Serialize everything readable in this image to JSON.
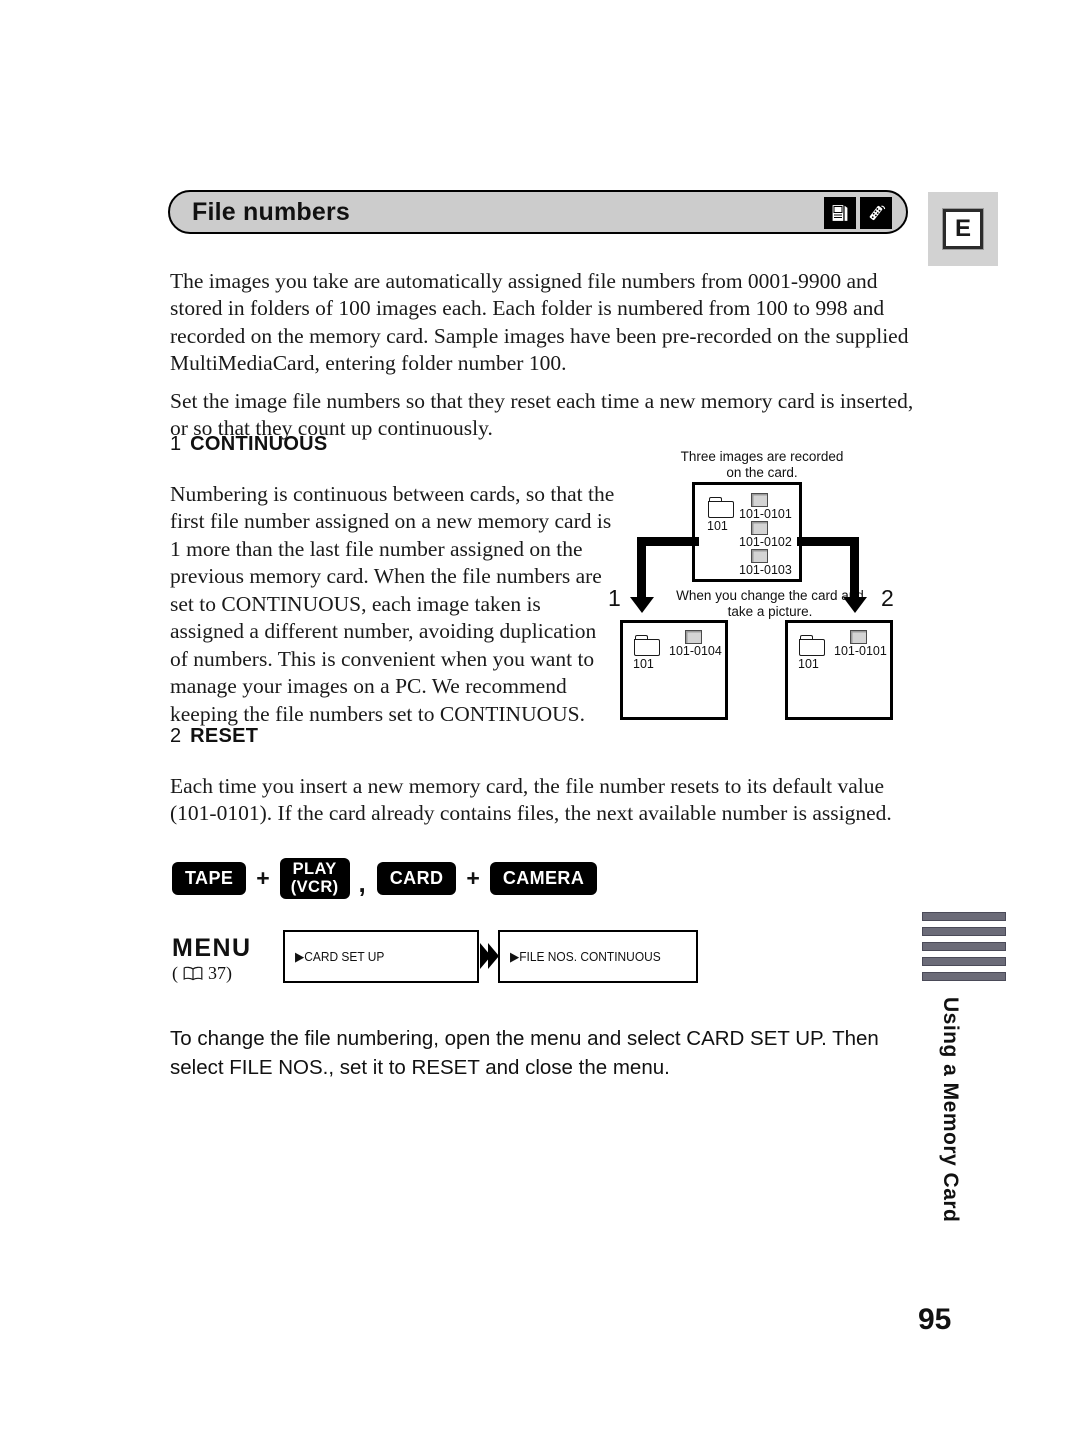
{
  "header": {
    "title": "File numbers",
    "icons": [
      "memory-card-icon",
      "remote-control-icon"
    ],
    "language_tab": "E"
  },
  "body": {
    "intro_paragraph": "The images you take are automatically assigned file numbers from 0001-9900 and stored in folders of 100 images each. Each folder is numbered from 100 to 998 and recorded on the memory card. Sample images have been pre-recorded on the supplied MultiMediaCard, entering folder number 100.",
    "set_paragraph": "Set the image file numbers so that they reset each time a new memory card is inserted, or so that they count up continuously."
  },
  "options": [
    {
      "index": "1",
      "label": "CONTINUOUS",
      "paragraph": "Numbering is continuous between cards, so that the first file number assigned on a new memory card is 1 more than the last file number assigned on the previous memory card. When the file numbers are set to CONTINUOUS, each image taken is assigned a different number, avoiding duplication of numbers. This is convenient when you want to manage your images on a PC. We recommend keeping the file numbers set to CONTINUOUS."
    },
    {
      "index": "2",
      "label": "RESET",
      "paragraph": "Each time you insert a new memory card, the file number resets to its default value (101-0101). If the card already contains files, the next available number is assigned."
    }
  ],
  "diagram": {
    "caption_top": "Three images are recorded on the card.",
    "caption_middle": "When you change the card and take a picture.",
    "branch_labels": {
      "left": "1",
      "right": "2"
    },
    "top_card": {
      "folder": "101",
      "files": [
        "101-0101",
        "101-0102",
        "101-0103"
      ]
    },
    "left_card": {
      "folder": "101",
      "files": [
        "101-0104"
      ]
    },
    "right_card": {
      "folder": "101",
      "files": [
        "101-0101"
      ]
    }
  },
  "badges": {
    "tape": "TAPE",
    "play_line1": "PLAY",
    "play_line2": "(VCR)",
    "card": "CARD",
    "camera": "CAMERA",
    "plus": "+",
    "comma": ","
  },
  "menu": {
    "label": "MENU",
    "reference_open": "(",
    "reference_page": "37)",
    "step_1": "CARD SET UP",
    "step_2": "FILE NOS.  CONTINUOUS",
    "arrow_marker": "▶"
  },
  "bottom_instruction": "To change the file numbering, open the menu and select CARD SET UP. Then select FILE NOS., set it to RESET and close the menu.",
  "side_tab": {
    "text": "Using a Memory Card",
    "bar_count": 5,
    "bar_color": "#6b6b78"
  },
  "page_number": "95"
}
